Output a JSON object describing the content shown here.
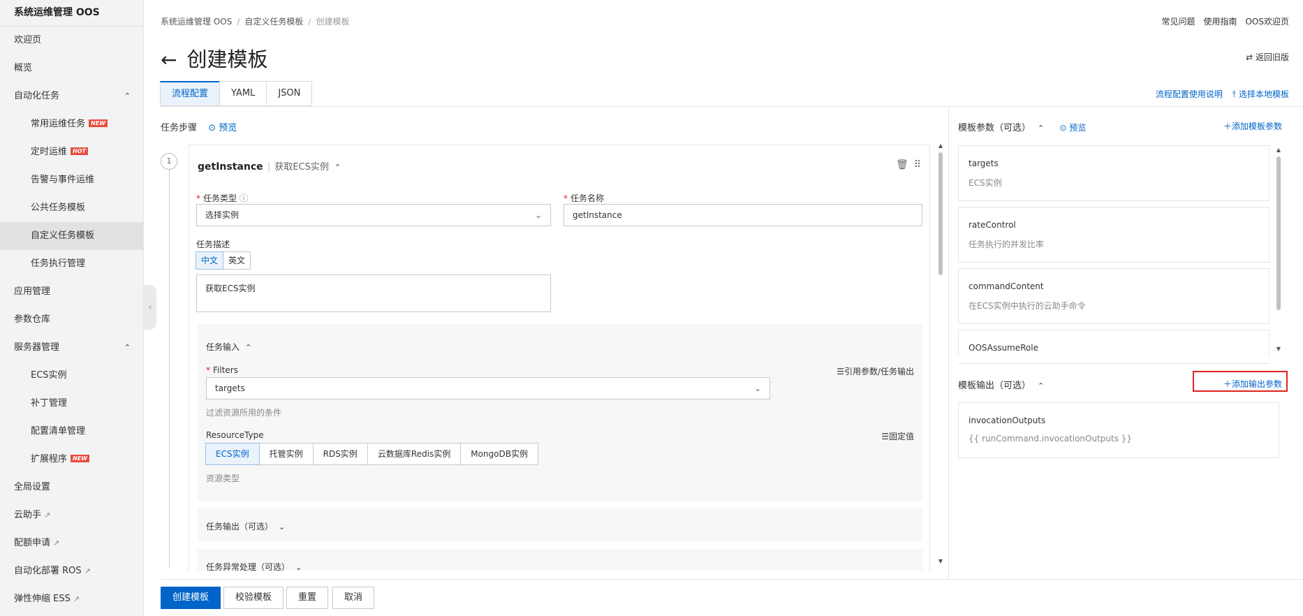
{
  "sidebar": {
    "title": "系统运维管理 OOS",
    "items": [
      {
        "label": "欢迎页"
      },
      {
        "label": "概览"
      },
      {
        "label": "自动化任务",
        "caret": "⌃"
      },
      {
        "label": "常用运维任务",
        "badge": "NEW"
      },
      {
        "label": "定时运维",
        "badge": "HOT"
      },
      {
        "label": "告警与事件运维"
      },
      {
        "label": "公共任务模板"
      },
      {
        "label": "自定义任务模板"
      },
      {
        "label": "任务执行管理"
      },
      {
        "label": "应用管理"
      },
      {
        "label": "参数仓库"
      },
      {
        "label": "服务器管理",
        "caret": "⌃"
      },
      {
        "label": "ECS实例"
      },
      {
        "label": "补丁管理"
      },
      {
        "label": "配置清单管理"
      },
      {
        "label": "扩展程序",
        "badge": "NEW"
      },
      {
        "label": "全局设置"
      },
      {
        "label": "云助手"
      },
      {
        "label": "配额申请"
      },
      {
        "label": "自动化部署 ROS"
      },
      {
        "label": "弹性伸缩 ESS"
      }
    ]
  },
  "breadcrumb": [
    "系统运维管理 OOS",
    "自定义任务模板",
    "创建模板"
  ],
  "top_links": [
    "常见问题",
    "使用指南",
    "OOS欢迎页"
  ],
  "page": {
    "title": "创建模板",
    "restore": "返回旧版"
  },
  "tabs": [
    "流程配置",
    "YAML",
    "JSON"
  ],
  "tab_actions": {
    "help": "流程配置使用说明",
    "upload": "选择本地模板"
  },
  "steps": {
    "title": "任务步骤",
    "preview": "预览"
  },
  "step": {
    "number": "1",
    "name": "getInstance",
    "desc": "获取ECS实例",
    "task_type_label": "任务类型",
    "task_type_value": "选择实例",
    "task_name_label": "任务名称",
    "task_name_value": "getInstance",
    "task_desc_label": "任务描述",
    "lang": [
      "中文",
      "英文"
    ],
    "desc_value": "获取ECS实例",
    "input_title": "任务输入",
    "filters_label": "Filters",
    "ref_link": "引用参数/任务输出",
    "filters_value": "targets",
    "filters_hint": "过滤资源所用的条件",
    "resource_label": "ResourceType",
    "fixed_link": "固定值",
    "resource_types": [
      "ECS实例",
      "托管实例",
      "RDS实例",
      "云数据库Redis实例",
      "MongoDB实例"
    ],
    "resource_hint": "资源类型",
    "output_title": "任务输出（可选）",
    "exception_title": "任务异常处理（可选）"
  },
  "right": {
    "params_title": "模板参数（可选）",
    "preview": "预览",
    "add_param": "添加模板参数",
    "params": [
      {
        "name": "targets",
        "desc": "ECS实例"
      },
      {
        "name": "rateControl",
        "desc": "任务执行的并发比率"
      },
      {
        "name": "commandContent",
        "desc": "在ECS实例中执行的云助手命令"
      },
      {
        "name": "OOSAssumeRole",
        "desc": ""
      }
    ],
    "outputs_title": "模板输出（可选）",
    "add_output": "添加输出参数",
    "outputs": [
      {
        "name": "invocationOutputs",
        "desc": "{{ runCommand.invocationOutputs }}"
      }
    ]
  },
  "footer": {
    "create": "创建模板",
    "validate": "校验模板",
    "reset": "重置",
    "cancel": "取消"
  },
  "colors": {
    "accent": "#0064c8",
    "badge": "#e84c3d",
    "highlight": "#e02020"
  }
}
